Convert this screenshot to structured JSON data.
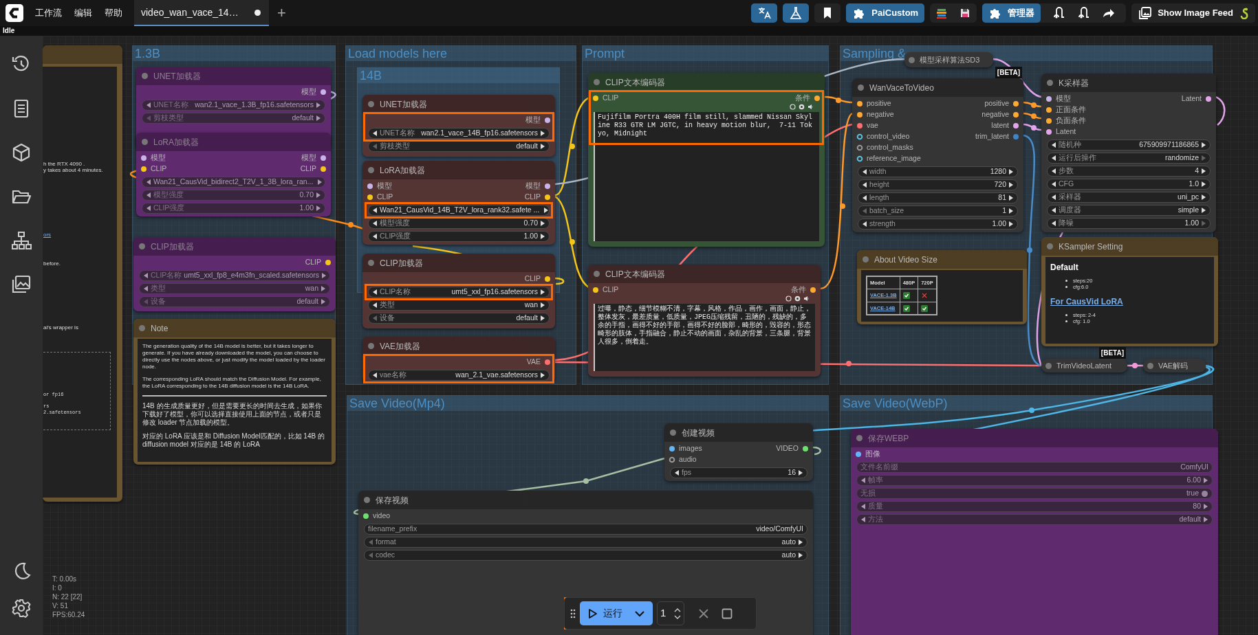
{
  "menu": [
    "工作流",
    "编辑",
    "帮助"
  ],
  "workflow_tabs": [
    {
      "label": "video_wan_vace_14…",
      "selected": true,
      "unsaved": true
    }
  ],
  "new_tab_button": "+",
  "toolbar": {
    "custom_button": "PaiCustom",
    "manager_button": "管理器",
    "feed_button": "Show Image Feed"
  },
  "status": "Idle",
  "groups": [
    {
      "title": "1.3B"
    },
    {
      "title": "Load models here"
    },
    {
      "title": "14B"
    },
    {
      "title": "Prompt"
    },
    {
      "title": "Sampling &"
    },
    {
      "title": "Save Video(Mp4)"
    },
    {
      "title": "Save Video(WebP)"
    }
  ],
  "nodes": [
    {
      "kind": "note",
      "color": "#6b5531",
      "bypassed": false,
      "highlight": false,
      "blocks": [
        {
          "kind": "fragment",
          "text": "h the RTX 4090 ."
        },
        {
          "kind": "fragment",
          "text": "y takes about 4 minutes."
        },
        {
          "kind": "link_fragment",
          "text": "ors"
        },
        {
          "kind": "fragment",
          "text": "before."
        },
        {
          "kind": "fragment",
          "text": "ai's wrapper is"
        },
        {
          "kind": "code",
          "text": "or fp16"
        },
        {
          "kind": "code",
          "text": "rs"
        },
        {
          "kind": "code",
          "text": "2.safetensors"
        }
      ]
    },
    {
      "kind": "node",
      "title": "UNET加载器",
      "color": "#5f2a6e",
      "bypassed": true,
      "highlight": false,
      "outputs": [
        {
          "label": "模型",
          "color": "#c8b4e8",
          "kind": "dot"
        }
      ],
      "widgets": [
        {
          "kind": "combo",
          "label": "UNET名称",
          "value": "wan2.1_vace_1.3B_fp16.safetensors"
        },
        {
          "kind": "combo",
          "label": "剪枝类型",
          "value": "default",
          "left_dim": true
        }
      ]
    },
    {
      "kind": "node",
      "title": "LoRA加载器",
      "color": "#5f2a6e",
      "bypassed": true,
      "highlight": false,
      "inputs": [
        {
          "label": "模型",
          "color": "#c8b4e8",
          "kind": "dot"
        },
        {
          "label": "CLIP",
          "color": "#f5c518",
          "kind": "dot"
        }
      ],
      "outputs": [
        {
          "label": "模型",
          "color": "#c8b4e8",
          "kind": "dot"
        },
        {
          "label": "CLIP",
          "color": "#f5c518",
          "kind": "dot"
        }
      ],
      "widgets": [
        {
          "kind": "combo",
          "value": "Wan21_CausVid_bidirect2_T2V_1_3B_lora_ran..."
        },
        {
          "kind": "number",
          "label": "模型强度",
          "value": "0.70"
        },
        {
          "kind": "number",
          "label": "CLIP强度",
          "value": "1.00"
        }
      ]
    },
    {
      "kind": "node",
      "title": "CLIP加载器",
      "color": "#5f2a6e",
      "bypassed": true,
      "highlight": false,
      "outputs": [
        {
          "label": "CLIP",
          "color": "#f5c518",
          "kind": "dot"
        }
      ],
      "widgets": [
        {
          "kind": "combo",
          "label": "CLIP名称",
          "value": "umt5_xxl_fp8_e4m3fn_scaled.safetensors"
        },
        {
          "kind": "combo",
          "label": "类型",
          "value": "wan"
        },
        {
          "kind": "combo",
          "label": "设备",
          "value": "default",
          "left_dim": true
        }
      ]
    },
    {
      "kind": "note",
      "title": "Note",
      "color": "#6b5531",
      "bypassed": false,
      "highlight": false,
      "blocks": [
        {
          "kind": "p",
          "text": "The generation quality of the 14B model is better, but it takes longer to generate. If you have already downloaded the model, you can choose to directly use the nodes above, or just modify the model loaded by the loader node."
        },
        {
          "kind": "p",
          "text": "The corresponding LoRA should match the Diffusion Model. For example, the LoRA corresponding to the 14B diffusion model is the 14B LoRA."
        },
        {
          "kind": "hr"
        },
        {
          "kind": "p",
          "text": "14B 的生成质量更好，但是需要更长的时间去生成，如果你下载好了模型，你可以选择直接使用上面的节点，或者只是修改 loader 节点加载的模型。"
        },
        {
          "kind": "p",
          "text": "对应的 LoRA 应该是和 Diffusion Model匹配的，比如 14B 的 diffusion model 对应的是 14B 的 LoRA"
        }
      ]
    },
    {
      "kind": "node",
      "title": "UNET加载器",
      "color": "#553434",
      "bypassed": false,
      "highlight": true,
      "outputs": [
        {
          "label": "模型",
          "color": "#c8b4e8",
          "kind": "dot"
        }
      ],
      "widgets": [
        {
          "kind": "combo",
          "label": "UNET名称",
          "value": "wan2.1_vace_14B_fp16.safetensors"
        },
        {
          "kind": "combo",
          "label": "剪枝类型",
          "value": "default",
          "left_dim": true
        }
      ]
    },
    {
      "kind": "node",
      "title": "LoRA加载器",
      "color": "#553434",
      "bypassed": false,
      "highlight": true,
      "inputs": [
        {
          "label": "模型",
          "color": "#c8b4e8",
          "kind": "dot"
        },
        {
          "label": "CLIP",
          "color": "#f5c518",
          "kind": "dot"
        }
      ],
      "outputs": [
        {
          "label": "模型",
          "color": "#c8b4e8",
          "kind": "dot"
        },
        {
          "label": "CLIP",
          "color": "#f5c518",
          "kind": "dot"
        }
      ],
      "widgets": [
        {
          "kind": "combo",
          "value": "Wan21_CausVid_14B_T2V_lora_rank32.safete ..."
        },
        {
          "kind": "number",
          "label": "模型强度",
          "value": "0.70"
        },
        {
          "kind": "number",
          "label": "CLIP强度",
          "value": "1.00"
        }
      ]
    },
    {
      "kind": "node",
      "title": "CLIP加载器",
      "color": "#553434",
      "bypassed": false,
      "highlight": true,
      "outputs": [
        {
          "label": "CLIP",
          "color": "#f5c518",
          "kind": "dot"
        }
      ],
      "widgets": [
        {
          "kind": "combo",
          "label": "CLIP名称",
          "value": "umt5_xxl_fp16.safetensors"
        },
        {
          "kind": "combo",
          "label": "类型",
          "value": "wan"
        },
        {
          "kind": "combo",
          "label": "设备",
          "value": "default",
          "left_dim": true
        }
      ]
    },
    {
      "kind": "node",
      "title": "VAE加载器",
      "color": "#553434",
      "bypassed": false,
      "highlight": true,
      "outputs": [
        {
          "label": "VAE",
          "color": "#ff6e6e",
          "kind": "dot"
        }
      ],
      "widgets": [
        {
          "kind": "combo",
          "label": "vae名称",
          "value": "wan_2.1_vae.safetensors"
        }
      ]
    },
    {
      "kind": "node",
      "title": "CLIP文本编码器",
      "color": "#365436",
      "bypassed": false,
      "highlight": true,
      "inputs": [
        {
          "label": "CLIP",
          "color": "#f5c518",
          "kind": "dot"
        }
      ],
      "outputs": [
        {
          "label": "条件",
          "color": "#ffa931",
          "kind": "dot"
        }
      ],
      "prompt": "Fujifilm Portra 400H film still, slammed Nissan Skyline R33 GTR LM JGTC, in heavy motion blur,  7-11 Tokyo, Midnight"
    },
    {
      "kind": "node",
      "title": "CLIP文本编码器",
      "color": "#553434",
      "bypassed": false,
      "highlight": false,
      "inputs": [
        {
          "label": "CLIP",
          "color": "#f5c518",
          "kind": "dot"
        }
      ],
      "outputs": [
        {
          "label": "条件",
          "color": "#ffa931",
          "kind": "dot"
        }
      ],
      "prompt": "过曝，静态，细节模糊不清，字幕，风格，作品，画作，画面，静止，整体发灰，最差质量，低质量，JPEG压缩残留，丑陋的，残缺的，多余的手指，画得不好的手部，画得不好的脸部，畸形的，毁容的，形态畸形的肢体，手指融合，静止不动的画面，杂乱的背景，三条腿，背景人很多，倒着走。"
    },
    {
      "kind": "collapsed",
      "title": "模型采样算法SD3",
      "color": "#353535",
      "bypassed": false,
      "highlight": false
    },
    {
      "kind": "node",
      "title": "WanVaceToVideo",
      "color": "#353535",
      "bypassed": false,
      "highlight": false,
      "badge": "[BETA]",
      "inputs": [
        {
          "label": "positive",
          "color": "#ffa931",
          "kind": "dot"
        },
        {
          "label": "negative",
          "color": "#ffa931",
          "kind": "dot"
        },
        {
          "label": "vae",
          "color": "#ff6e6e",
          "kind": "dot"
        },
        {
          "label": "control_video",
          "color": "#5bc0de",
          "kind": "ring"
        },
        {
          "label": "control_masks",
          "color": "#9a9a9a",
          "kind": "ring"
        },
        {
          "label": "reference_image",
          "color": "#5bc0de",
          "kind": "ring"
        }
      ],
      "outputs": [
        {
          "label": "positive",
          "color": "#ffa931",
          "kind": "dot"
        },
        {
          "label": "negative",
          "color": "#ffa931",
          "kind": "dot"
        },
        {
          "label": "latent",
          "color": "#e4a4ec",
          "kind": "dot"
        },
        {
          "label": "trim_latent",
          "color": "#3d85c6",
          "kind": "dot"
        }
      ],
      "widgets": [
        {
          "kind": "number",
          "label": "width",
          "value": "1280"
        },
        {
          "kind": "number",
          "label": "height",
          "value": "720"
        },
        {
          "kind": "number",
          "label": "length",
          "value": "81"
        },
        {
          "kind": "number",
          "label": "batch_size",
          "value": "1",
          "left_dim": true
        },
        {
          "kind": "number",
          "label": "strength",
          "value": "1.00"
        }
      ]
    },
    {
      "kind": "node",
      "title": "K采样器",
      "color": "#353535",
      "bypassed": false,
      "highlight": false,
      "inputs": [
        {
          "label": "模型",
          "color": "#c8b4e8",
          "kind": "dot"
        },
        {
          "label": "正面条件",
          "color": "#ffa931",
          "kind": "dot"
        },
        {
          "label": "负面条件",
          "color": "#ffa931",
          "kind": "dot"
        },
        {
          "label": "Latent",
          "color": "#e4a4ec",
          "kind": "dot"
        }
      ],
      "outputs": [
        {
          "label": "Latent",
          "color": "#e4a4ec",
          "kind": "dot"
        }
      ],
      "widgets": [
        {
          "kind": "number",
          "label": "随机种",
          "value": "675909971186865"
        },
        {
          "kind": "combo",
          "label": "运行后操作",
          "value": "randomize",
          "right_dim": true
        },
        {
          "kind": "number",
          "label": "步数",
          "value": "4"
        },
        {
          "kind": "number",
          "label": "CFG",
          "value": "1.0"
        },
        {
          "kind": "combo",
          "label": "采样器",
          "value": "uni_pc"
        },
        {
          "kind": "combo",
          "label": "调度器",
          "value": "simple"
        },
        {
          "kind": "number",
          "label": "降噪",
          "value": "1.00",
          "right_dim": true
        }
      ]
    },
    {
      "kind": "note",
      "title": "About Video Size",
      "color": "#6b5531",
      "bypassed": false,
      "highlight": false,
      "blocks": [
        {
          "kind": "table",
          "columns": [
            "Model",
            "480P",
            "720P"
          ],
          "rows": [
            {
              "model": "VACE-1.3B",
              "p480": true,
              "p720": false
            },
            {
              "model": "VACE-14B",
              "p480": true,
              "p720": true
            }
          ]
        }
      ]
    },
    {
      "kind": "note",
      "title": "KSampler Setting",
      "color": "#6b5531",
      "bypassed": false,
      "highlight": false,
      "blocks": [
        {
          "kind": "heading",
          "text": "Default"
        },
        {
          "kind": "list",
          "items": [
            "steps:20",
            "cfg:6.0"
          ]
        },
        {
          "kind": "link_heading",
          "text": "For CausVid LoRA"
        },
        {
          "kind": "list",
          "items": [
            "steps: 2-4",
            "cfg: 1.0"
          ]
        }
      ]
    },
    {
      "kind": "collapsed",
      "title": "TrimVideoLatent",
      "color": "#353535",
      "bypassed": false,
      "highlight": false,
      "badge": "[BETA]"
    },
    {
      "kind": "collapsed",
      "title": "VAE解码",
      "color": "#353535",
      "bypassed": false,
      "highlight": false
    },
    {
      "kind": "node",
      "title": "创建视频",
      "color": "#353535",
      "bypassed": false,
      "highlight": false,
      "inputs": [
        {
          "label": "images",
          "color": "#64b5f6",
          "kind": "dot"
        },
        {
          "label": "audio",
          "color": "#9a9a9a",
          "kind": "ring"
        }
      ],
      "outputs": [
        {
          "label": "VIDEO",
          "color": "#6ee06e",
          "kind": "dot"
        }
      ],
      "widgets": [
        {
          "kind": "number",
          "label": "fps",
          "value": "16"
        }
      ]
    },
    {
      "kind": "node",
      "title": "保存视频",
      "color": "#353535",
      "bypassed": false,
      "highlight": false,
      "inputs": [
        {
          "label": "video",
          "color": "#6ee06e",
          "kind": "dot"
        }
      ],
      "widgets": [
        {
          "kind": "text",
          "label": "filename_prefix",
          "value": "video/ComfyUI"
        },
        {
          "kind": "combo",
          "label": "format",
          "value": "auto",
          "left_dim": true
        },
        {
          "kind": "combo",
          "label": "codec",
          "value": "auto",
          "left_dim": true
        }
      ]
    },
    {
      "kind": "node",
      "title": "保存WEBP",
      "color": "#5f2a6e",
      "bypassed": true,
      "highlight": false,
      "inputs": [
        {
          "label": "图像",
          "color": "#64b5f6",
          "kind": "dot"
        }
      ],
      "widgets": [
        {
          "kind": "text",
          "label": "文件名前缀",
          "value": "ComfyUI"
        },
        {
          "kind": "number",
          "label": "帧率",
          "value": "6.00"
        },
        {
          "kind": "toggle",
          "label": "无损",
          "value": "true"
        },
        {
          "kind": "number",
          "label": "质量",
          "value": "80"
        },
        {
          "kind": "combo",
          "label": "方法",
          "value": "default"
        }
      ]
    }
  ],
  "stats": [
    "T: 0.00s",
    "I: 0",
    "N: 22 [22]",
    "V: 51",
    "FPS:60.24"
  ],
  "run_bar": {
    "run_label": "运行",
    "count": "1",
    "highlight": true
  }
}
